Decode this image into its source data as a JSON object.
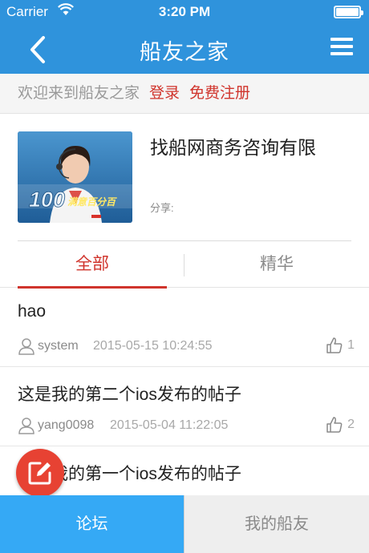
{
  "status_bar": {
    "carrier": "Carrier",
    "time": "3:20 PM"
  },
  "navbar": {
    "title": "船友之家",
    "back_icon": "chevron-left-icon",
    "menu_icon": "hamburger-menu-icon"
  },
  "welcome": {
    "text": "欢迎来到船友之家",
    "login": "登录",
    "register": "免费注册"
  },
  "profile": {
    "name": "找船网商务咨询有限",
    "share_label": "分享:",
    "banner_text": "100",
    "banner_subtext": "满意百分百"
  },
  "tabs": [
    {
      "label": "全部",
      "active": true
    },
    {
      "label": "精华",
      "active": false
    }
  ],
  "posts": [
    {
      "title": "hao",
      "author": "system",
      "date": "2015-05-15 10:24:55",
      "likes": "1"
    },
    {
      "title": "这是我的第二个ios发布的帖子",
      "author": "yang0098",
      "date": "2015-05-04 11:22:05",
      "likes": "2"
    },
    {
      "title": "这是我的第一个ios发布的帖子",
      "author": "",
      "date": "",
      "likes": ""
    }
  ],
  "bottom_tabs": [
    {
      "label": "论坛",
      "active": true
    },
    {
      "label": "我的船友",
      "active": false
    }
  ],
  "colors": {
    "primary": "#2f93dc",
    "accent_red": "#d0342c",
    "fab": "#e74233",
    "bottom_active": "#35a9f5"
  }
}
